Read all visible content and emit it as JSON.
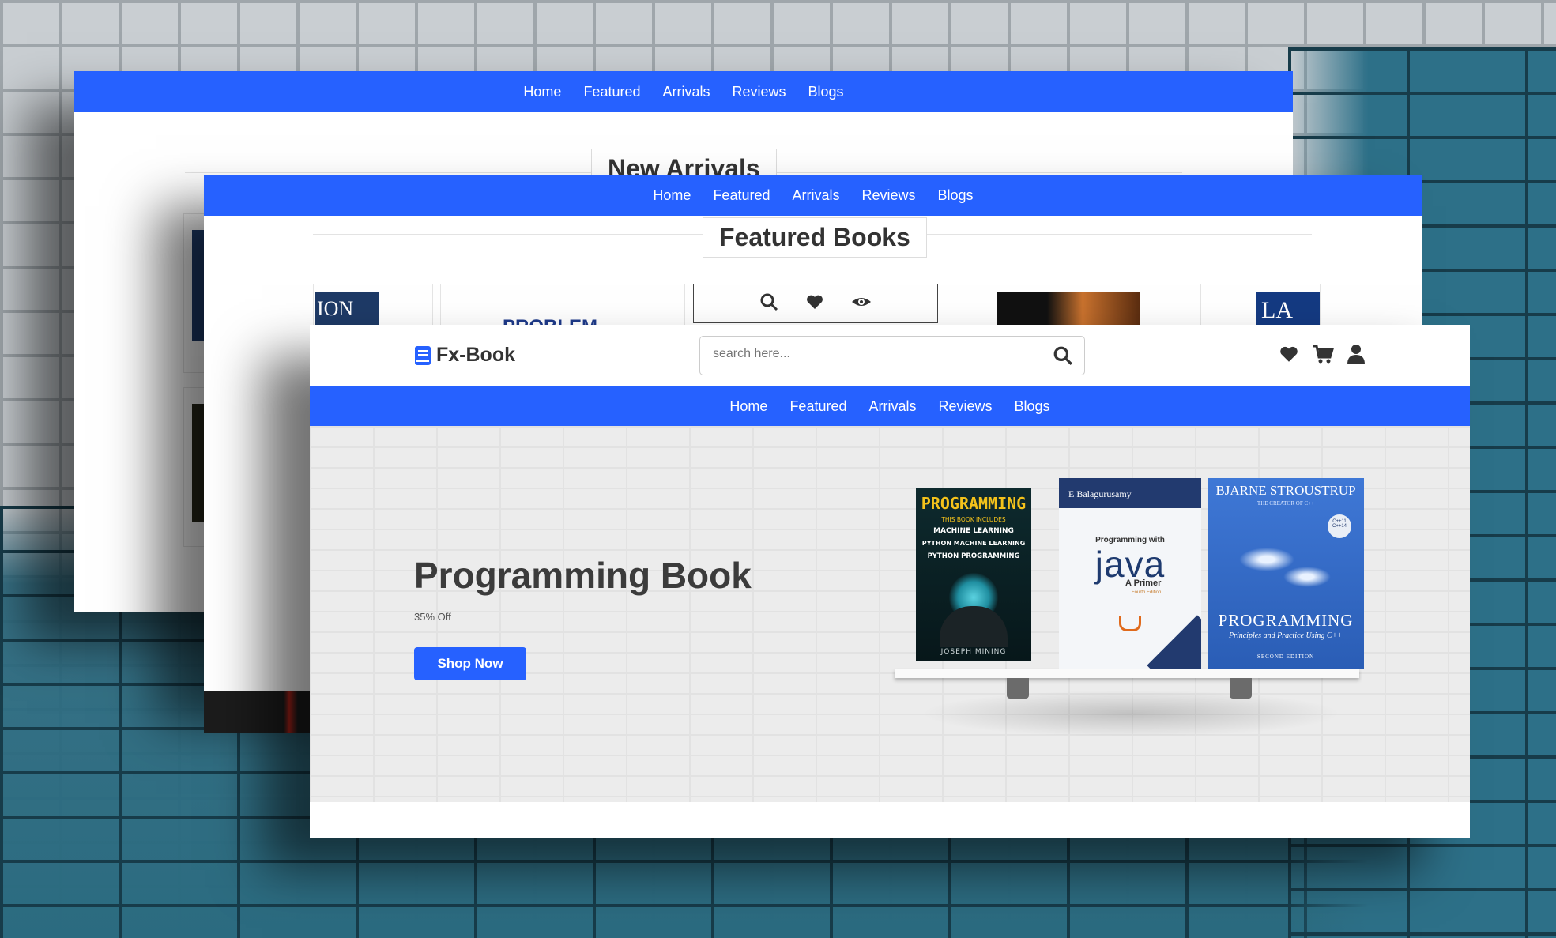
{
  "nav": {
    "home": "Home",
    "featured": "Featured",
    "arrivals": "Arrivals",
    "reviews": "Reviews",
    "blogs": "Blogs"
  },
  "back_screen": {
    "section_title": "New Arrivals"
  },
  "middle_screen": {
    "section_title": "Featured Books",
    "card_snippets": {
      "a": "ION",
      "b": "PROBLEM",
      "c": "LA"
    },
    "card_icons": [
      "search-icon",
      "heart-icon",
      "eye-icon"
    ]
  },
  "front_screen": {
    "logo": {
      "text": "Fx-Book",
      "icon": "book-icon"
    },
    "search": {
      "placeholder": "search here..."
    },
    "header_icons": [
      "heart-icon",
      "cart-icon",
      "user-icon"
    ],
    "hero": {
      "title": "Programming Book",
      "subtitle": "35% Off",
      "button": "Shop Now"
    },
    "books": [
      {
        "title": "PROGRAMMING",
        "line1": "THIS BOOK INCLUDES",
        "line2": "MACHINE LEARNING",
        "line3": "PYTHON MACHINE LEARNING",
        "line4": "PYTHON PROGRAMMING",
        "author": "JOSEPH MINING"
      },
      {
        "author": "E Balagurusamy",
        "title_top": "Programming with",
        "title_main": "java",
        "subtitle": "A Primer",
        "edition": "Fourth Edition"
      },
      {
        "author": "BJARNE STROUSTRUP",
        "tagline": "THE CREATOR OF C++",
        "badge1": "C++11",
        "badge2": "C++14",
        "title": "PROGRAMMING",
        "subtitle": "Principles and Practice Using C++",
        "edition": "SECOND EDITION"
      }
    ]
  },
  "colors": {
    "primary": "#2661ff",
    "text_dark": "#333333",
    "hero_bg": "#ececec"
  }
}
